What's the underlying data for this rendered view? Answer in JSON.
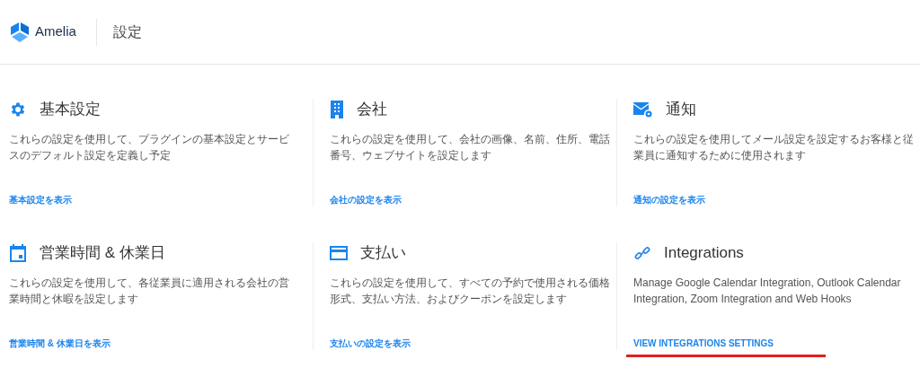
{
  "header": {
    "brand": "Amelia",
    "title": "設定"
  },
  "cards": [
    {
      "kind": "gear",
      "title": "基本設定",
      "description": "これらの設定を使用して、プラグインの基本設定とサービスのデフォルト設定を定義し予定",
      "link": "基本設定を表示",
      "underlined": false
    },
    {
      "kind": "building",
      "title": "会社",
      "description": "これらの設定を使用して、会社の画像、名前、住所、電話番号、ウェブサイトを設定します",
      "link": "会社の設定を表示",
      "underlined": false
    },
    {
      "kind": "mail",
      "title": "通知",
      "description": "これらの設定を使用してメール設定を設定するお客様と従業員に通知するために使用されます",
      "link": "通知の設定を表示",
      "underlined": false
    },
    {
      "kind": "calendar",
      "title": "営業時間 & 休業日",
      "description": "これらの設定を使用して、各従業員に適用される会社の営業時間と休暇を設定します",
      "link": "営業時間 & 休業日を表示",
      "underlined": false
    },
    {
      "kind": "card",
      "title": "支払い",
      "description": "これらの設定を使用して、すべての予約で使用される価格形式、支払い方法、およびクーポンを設定します",
      "link": "支払いの設定を表示",
      "underlined": false
    },
    {
      "kind": "link",
      "title": "Integrations",
      "description": "Manage Google Calendar Integration, Outlook Calendar Integration, Zoom Integration and Web Hooks",
      "link": "VIEW INTEGRATIONS SETTINGS",
      "underlined": true
    }
  ]
}
